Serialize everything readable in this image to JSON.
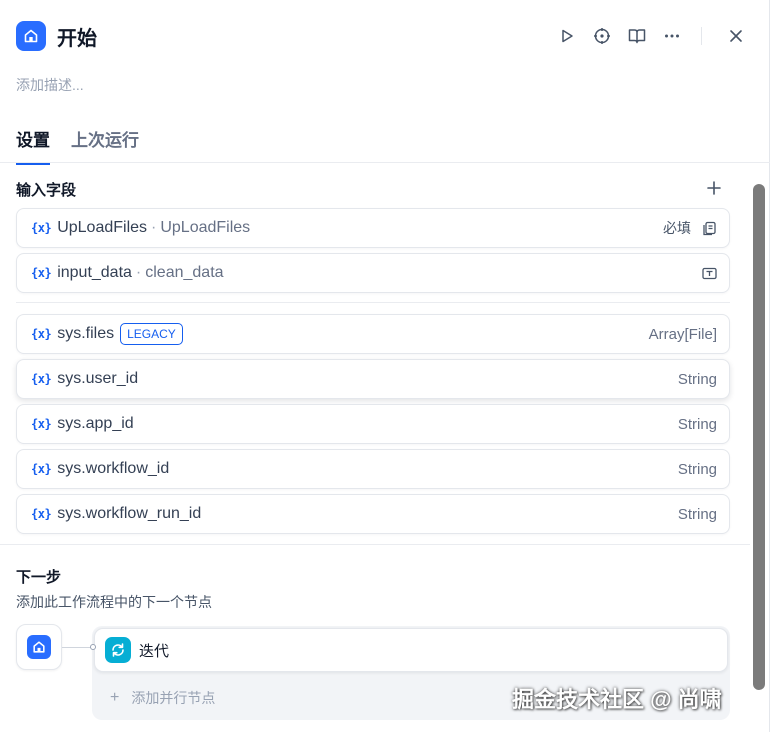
{
  "header": {
    "title": "开始",
    "description_placeholder": "添加描述..."
  },
  "tabs": [
    {
      "label": "设置",
      "active": true
    },
    {
      "label": "上次运行",
      "active": false
    }
  ],
  "input_fields": {
    "title": "输入字段",
    "user_vars": [
      {
        "name": "UpLoadFiles",
        "label": "UpLoadFiles",
        "required": "必填"
      },
      {
        "name": "input_data",
        "label": "clean_data"
      }
    ],
    "sys_vars": [
      {
        "name": "sys.files",
        "badge": "LEGACY",
        "type": "Array[File]"
      },
      {
        "name": "sys.user_id",
        "type": "String"
      },
      {
        "name": "sys.app_id",
        "type": "String"
      },
      {
        "name": "sys.workflow_id",
        "type": "String"
      },
      {
        "name": "sys.workflow_run_id",
        "type": "String"
      }
    ],
    "var_icon": "{x}"
  },
  "next_step": {
    "title": "下一步",
    "subtitle": "添加此工作流程中的下一个节点",
    "node_label": "迭代",
    "add_parallel": "添加并行节点"
  },
  "watermark": "掘金技术社区 @ 尚啸",
  "colors": {
    "accent": "#155eef",
    "start_node": "#296dff",
    "iteration_node": "#06aed4"
  }
}
